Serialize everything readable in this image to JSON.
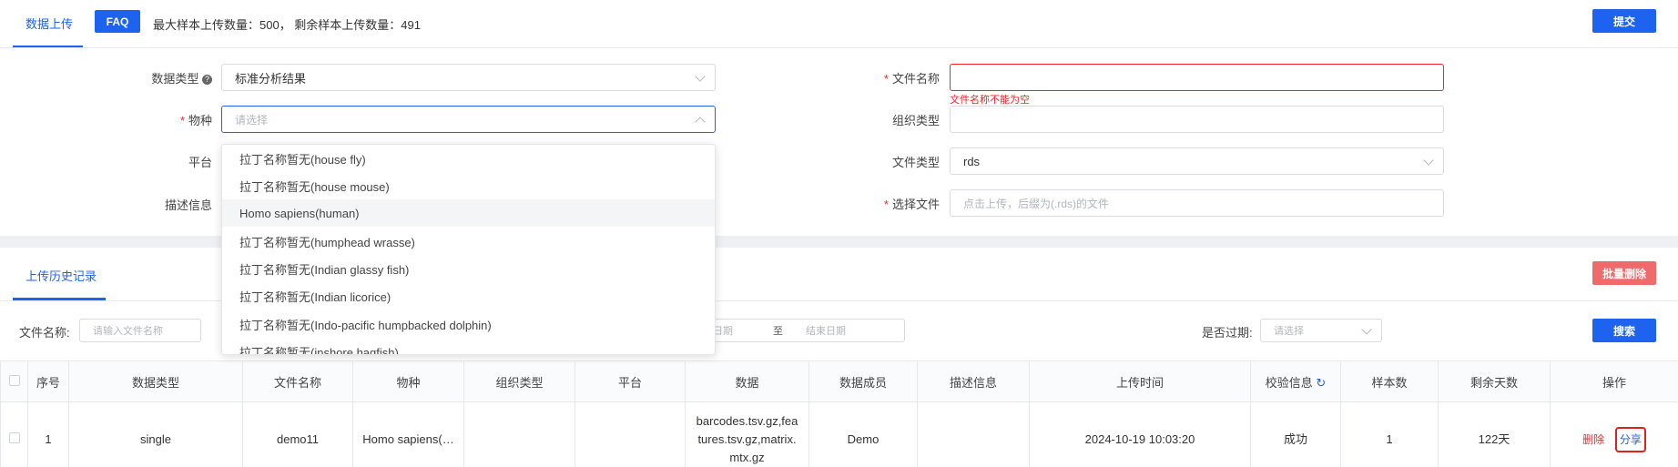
{
  "tabs": {
    "upload": "数据上传",
    "history": "上传历史记录"
  },
  "header": {
    "faq_label": "FAQ",
    "quota_text": "最大样本上传数量：500， 剩余样本上传数量：491",
    "submit_label": "提交"
  },
  "form": {
    "data_type": {
      "label": "数据类型",
      "value": "标准分析结果"
    },
    "species": {
      "label": "物种",
      "placeholder": "请选择"
    },
    "platform": {
      "label": "平台"
    },
    "description": {
      "label": "描述信息"
    },
    "file_name": {
      "label": "文件名称",
      "error": "文件名称不能为空"
    },
    "tissue_type": {
      "label": "组织类型"
    },
    "file_type": {
      "label": "文件类型",
      "value": "rds"
    },
    "select_file": {
      "label": "选择文件",
      "placeholder": "点击上传，后缀为(.rds)的文件"
    }
  },
  "species_dropdown": {
    "options": [
      "拉丁名称暂无(house fly)",
      "拉丁名称暂无(house mouse)",
      "Homo sapiens(human)",
      "拉丁名称暂无(humphead wrasse)",
      "拉丁名称暂无(Indian glassy fish)",
      "拉丁名称暂无(Indian licorice)",
      "拉丁名称暂无(Indo-pacific humpbacked dolphin)",
      "拉丁名称暂无(inshore hagfish)"
    ],
    "highlighted_index": 2
  },
  "history": {
    "batch_delete_label": "批量删除",
    "search_label": "搜索",
    "filters": {
      "file_name_label": "文件名称:",
      "file_name_placeholder": "请输入文件名称",
      "start_date_placeholder": "日期",
      "date_separator": "至",
      "end_date_placeholder": "结束日期",
      "expired_label": "是否过期:",
      "expired_placeholder": "请选择"
    },
    "columns": [
      "序号",
      "数据类型",
      "文件名称",
      "物种",
      "组织类型",
      "平台",
      "数据",
      "数据成员",
      "描述信息",
      "上传时间",
      "校验信息",
      "样本数",
      "剩余天数",
      "操作"
    ],
    "rows": [
      {
        "index": "1",
        "data_type": "single",
        "file_name": "demo11",
        "species": "Homo sapiens(…",
        "tissue_type": "",
        "platform": "",
        "data": "barcodes.tsv.gz,features.tsv.gz,matrix.mtx.gz",
        "member": "Demo",
        "description": "",
        "upload_time": "2024-10-19 10:03:20",
        "check": "成功",
        "samples": "1",
        "days_left": "122天",
        "delete_label": "删除",
        "share_label": "分享"
      }
    ]
  },
  "colors": {
    "primary": "#1e62f0",
    "danger": "#f5222d",
    "danger_button": "#ef6b6b",
    "divider_band": "#eef0f4"
  },
  "icons": {
    "help": "question-circle-icon",
    "refresh": "refresh-icon",
    "chevron": "chevron-down-icon"
  }
}
